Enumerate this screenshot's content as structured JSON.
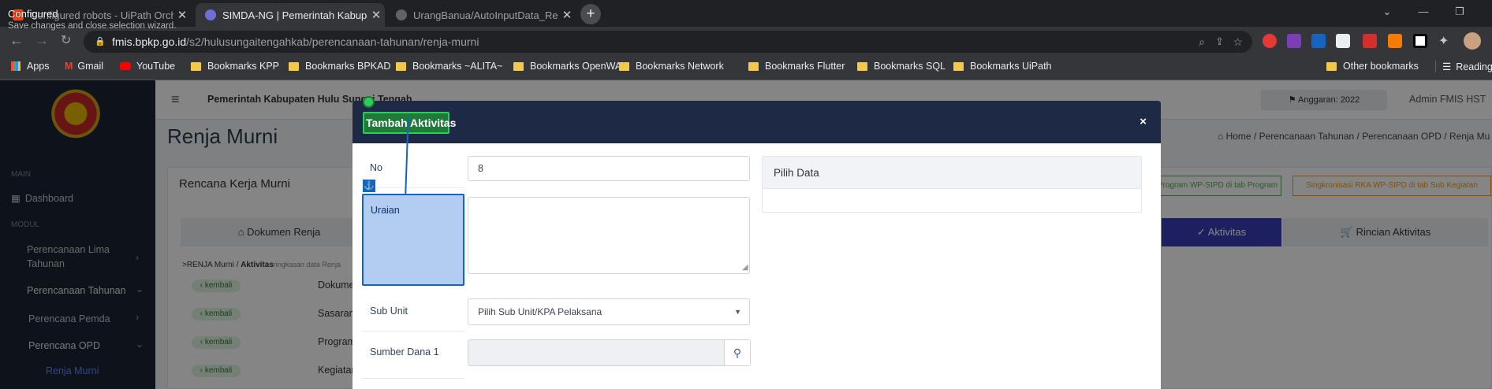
{
  "browser": {
    "tabs": [
      {
        "title": "Configured robots - UiPath Orch",
        "active": false
      },
      {
        "title": "SIMDA-NG | Pemerintah Kabupat",
        "active": true
      },
      {
        "title": "UrangBanua/AutoInputData_Ren",
        "active": false
      }
    ],
    "url_host": "fmis.bpkp.go.id",
    "url_path": "/s2/hulusungaitengahkab/perencanaan-tahunan/renja-murni",
    "tooltip_title": "Configured",
    "tooltip_sub": "Save changes and close selection wizard.",
    "bookmarks": [
      "Apps",
      "Gmail",
      "YouTube",
      "Bookmarks KPP",
      "Bookmarks BPKAD",
      "Bookmarks ~ALITA~",
      "Bookmarks OpenWA",
      "Bookmarks Network",
      "Bookmarks Flutter",
      "Bookmarks SQL",
      "Bookmarks UiPath"
    ],
    "other_bookmarks": "Other bookmarks",
    "reading_list": "Reading l"
  },
  "sidebar": {
    "section_main": "MAIN",
    "dashboard": "Dashboard",
    "section_modul": "MODUL",
    "perencanaan_lima": "Perencanaan Lima",
    "perencanaan_lima_2": "Tahunan",
    "perencanaan_tahunan": "Perencanaan Tahunan",
    "perencana_pemda": "Perencana Pemda",
    "perencana_opd": "Perencana OPD",
    "renja_murni": "Renja Murni"
  },
  "header": {
    "org": "Pemerintah Kabupaten Hulu Sungai Tengah",
    "anggaran": "Anggaran: 2022",
    "user": "Admin FMIS HST"
  },
  "content": {
    "page_title": "Renja Murni",
    "breadcrumb": [
      "Home",
      "Perencanaan Tahunan",
      "Perencanaan OPD",
      "Renja Mu"
    ],
    "card_title": "Rencana Kerja Murni",
    "btn_program": "Program WP-SIPD di tab Program",
    "btn_sinkron": "Singkronisasi RKA WP-SIPD di tab Sub Kegiatan",
    "tab_dokumen": "Dokumen Renja",
    "tab_aktivitas": "Aktivitas",
    "tab_rincian": "Rincian Aktivitas",
    "path_prefix": ">RENJA Murni / ",
    "path_current": "Aktivitas",
    "path_hint": "ringkasan data Renja",
    "kembali": "kembali",
    "rows": [
      "Dokume",
      "Sasaran",
      "Program",
      "Kegiatan"
    ]
  },
  "modal": {
    "title": "Tambah Aktivitas",
    "close": "×",
    "no_label": "No",
    "no_value": "8",
    "uraian_label": "Uraian",
    "uraian_value": "",
    "subunit_label": "Sub Unit",
    "subunit_value": "Pilih Sub Unit/KPA Pelaksana",
    "sumber_label": "Sumber Dana 1",
    "sumber_value": "",
    "pilih_data": "Pilih Data"
  }
}
